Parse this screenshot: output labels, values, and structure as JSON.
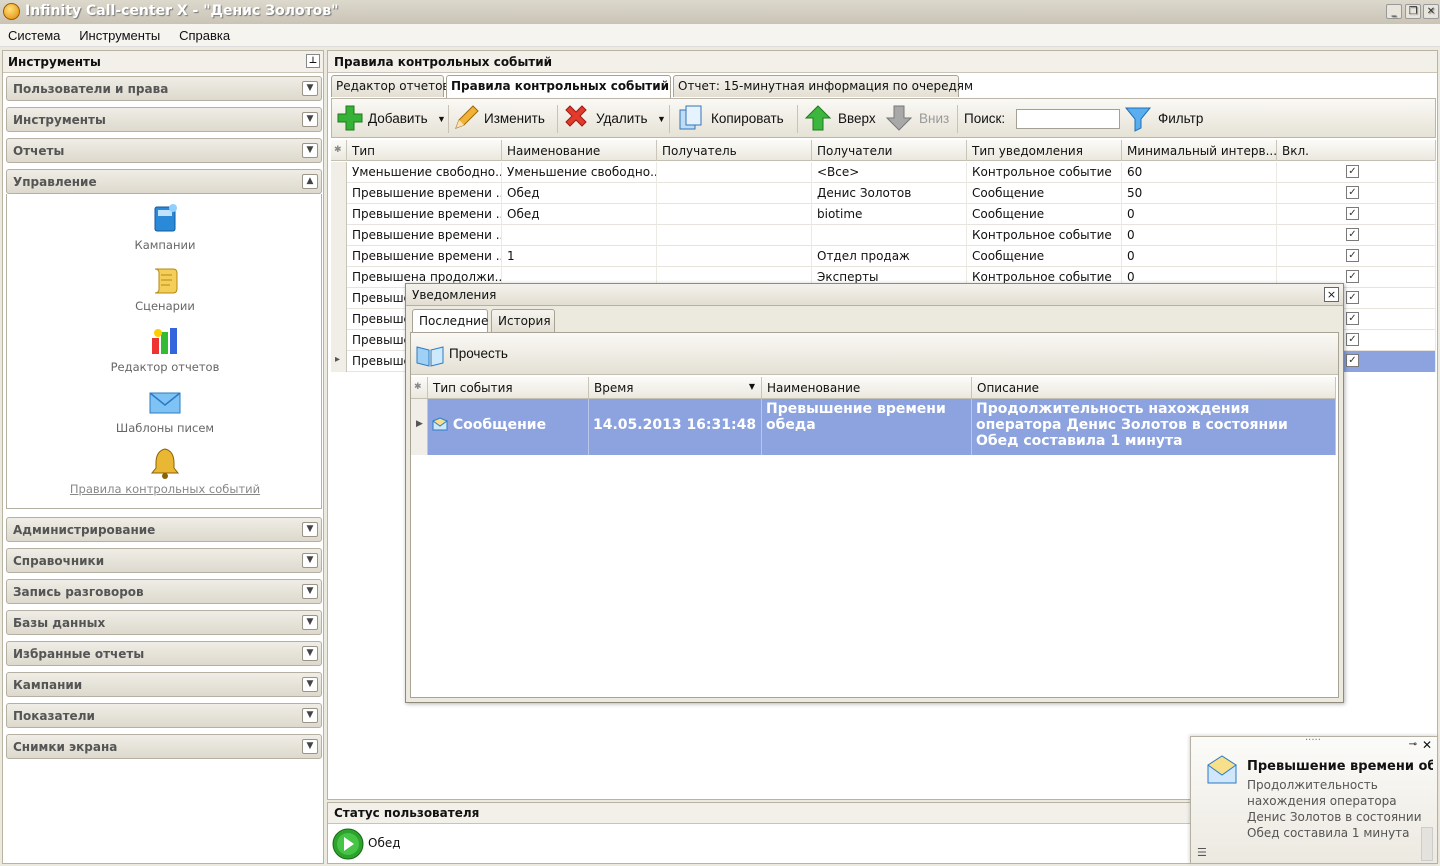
{
  "window": {
    "title": "Infinity Call-center X - \"Денис Золотов\""
  },
  "menu": [
    "Система",
    "Инструменты",
    "Справка"
  ],
  "left_panel": {
    "title": "Инструменты",
    "sections_top": [
      "Пользователи и права",
      "Инструменты",
      "Отчеты"
    ],
    "expanded": {
      "title": "Управление",
      "items": [
        {
          "label": "Кампании",
          "icon": "campaign-book-icon"
        },
        {
          "label": "Сценарии",
          "icon": "scroll-icon"
        },
        {
          "label": "Редактор отчетов",
          "icon": "report-editor-icon"
        },
        {
          "label": "Шаблоны писем",
          "icon": "envelope-icon"
        },
        {
          "label": "Правила контрольных событий",
          "icon": "bell-icon"
        }
      ]
    },
    "sections_bottom": [
      "Администрирование",
      "Справочники",
      "Запись разговоров",
      "Базы данных",
      "Избранные отчеты",
      "Кампании",
      "Показатели",
      "Снимки экрана"
    ]
  },
  "main": {
    "title": "Правила контрольных событий",
    "tabs": [
      "Редактор отчетов",
      "Правила контрольных событий",
      "Отчет: 15-минутная информация по очередям"
    ],
    "toolbar": {
      "add": "Добавить",
      "edit": "Изменить",
      "delete": "Удалить",
      "copy": "Копировать",
      "up": "Вверх",
      "down": "Вниз",
      "search_label": "Поиск:",
      "search_value": "",
      "filter": "Фильтр"
    },
    "grid": {
      "columns": [
        "Тип",
        "Наименование",
        "Получатель",
        "Получатели",
        "Тип уведомления",
        "Минимальный интерв...",
        "Вкл."
      ],
      "rows": [
        {
          "type": "Уменьшение свободно...",
          "name": "Уменьшение свободно...",
          "recipient": "",
          "recipients": "<Все>",
          "notify": "Контрольное событие",
          "interval": "60",
          "on": true
        },
        {
          "type": "Превышение времени ...",
          "name": "Обед",
          "recipient": "",
          "recipients": "Денис Золотов",
          "notify": "Сообщение",
          "interval": "50",
          "on": true
        },
        {
          "type": "Превышение времени ...",
          "name": "Обед",
          "recipient": "",
          "recipients": "biotime",
          "notify": "Сообщение",
          "interval": "0",
          "on": true
        },
        {
          "type": "Превышение времени ...",
          "name": "",
          "recipient": "",
          "recipients": "",
          "notify": "Контрольное событие",
          "interval": "0",
          "on": true
        },
        {
          "type": "Превышение времени ...",
          "name": "1",
          "recipient": "",
          "recipients": "Отдел продаж",
          "notify": "Сообщение",
          "interval": "0",
          "on": true
        },
        {
          "type": "Превышена продолжи...",
          "name": "",
          "recipient": "",
          "recipients": "Эксперты",
          "notify": "Контрольное событие",
          "interval": "0",
          "on": true
        },
        {
          "type": "Превыше",
          "name": "",
          "recipient": "",
          "recipients": "",
          "notify": "",
          "interval": "",
          "on": true
        },
        {
          "type": "Превыше",
          "name": "",
          "recipient": "",
          "recipients": "",
          "notify": "",
          "interval": "",
          "on": true
        },
        {
          "type": "Превыше",
          "name": "",
          "recipient": "",
          "recipients": "",
          "notify": "",
          "interval": "",
          "on": true
        },
        {
          "type": "Превыше",
          "name": "",
          "recipient": "",
          "recipients": "",
          "notify": "",
          "interval": "",
          "on": true
        }
      ]
    }
  },
  "dialog": {
    "title": "Уведомления",
    "close": "×",
    "tabs": [
      "Последние",
      "История"
    ],
    "read_button": "Прочесть",
    "columns": [
      "Тип события",
      "Время",
      "Наименование",
      "Описание"
    ],
    "row": {
      "type": "Сообщение",
      "time": "14.05.2013 16:31:48",
      "name": "Превышение времени обеда",
      "description": "Продолжительность нахождения оператора Денис Золотов в состоянии Обед составила 1 минута"
    }
  },
  "status_panel": {
    "title": "Статус пользователя",
    "value": "Обед"
  },
  "toast": {
    "title": "Превышение времени об...",
    "text": "Продолжительность нахождения оператора Денис Золотов в состоянии Обед составила 1 минута"
  },
  "colors": {
    "selection": "#8ca3e0",
    "frame": "#ece9df",
    "accent_green": "#2da32d"
  }
}
